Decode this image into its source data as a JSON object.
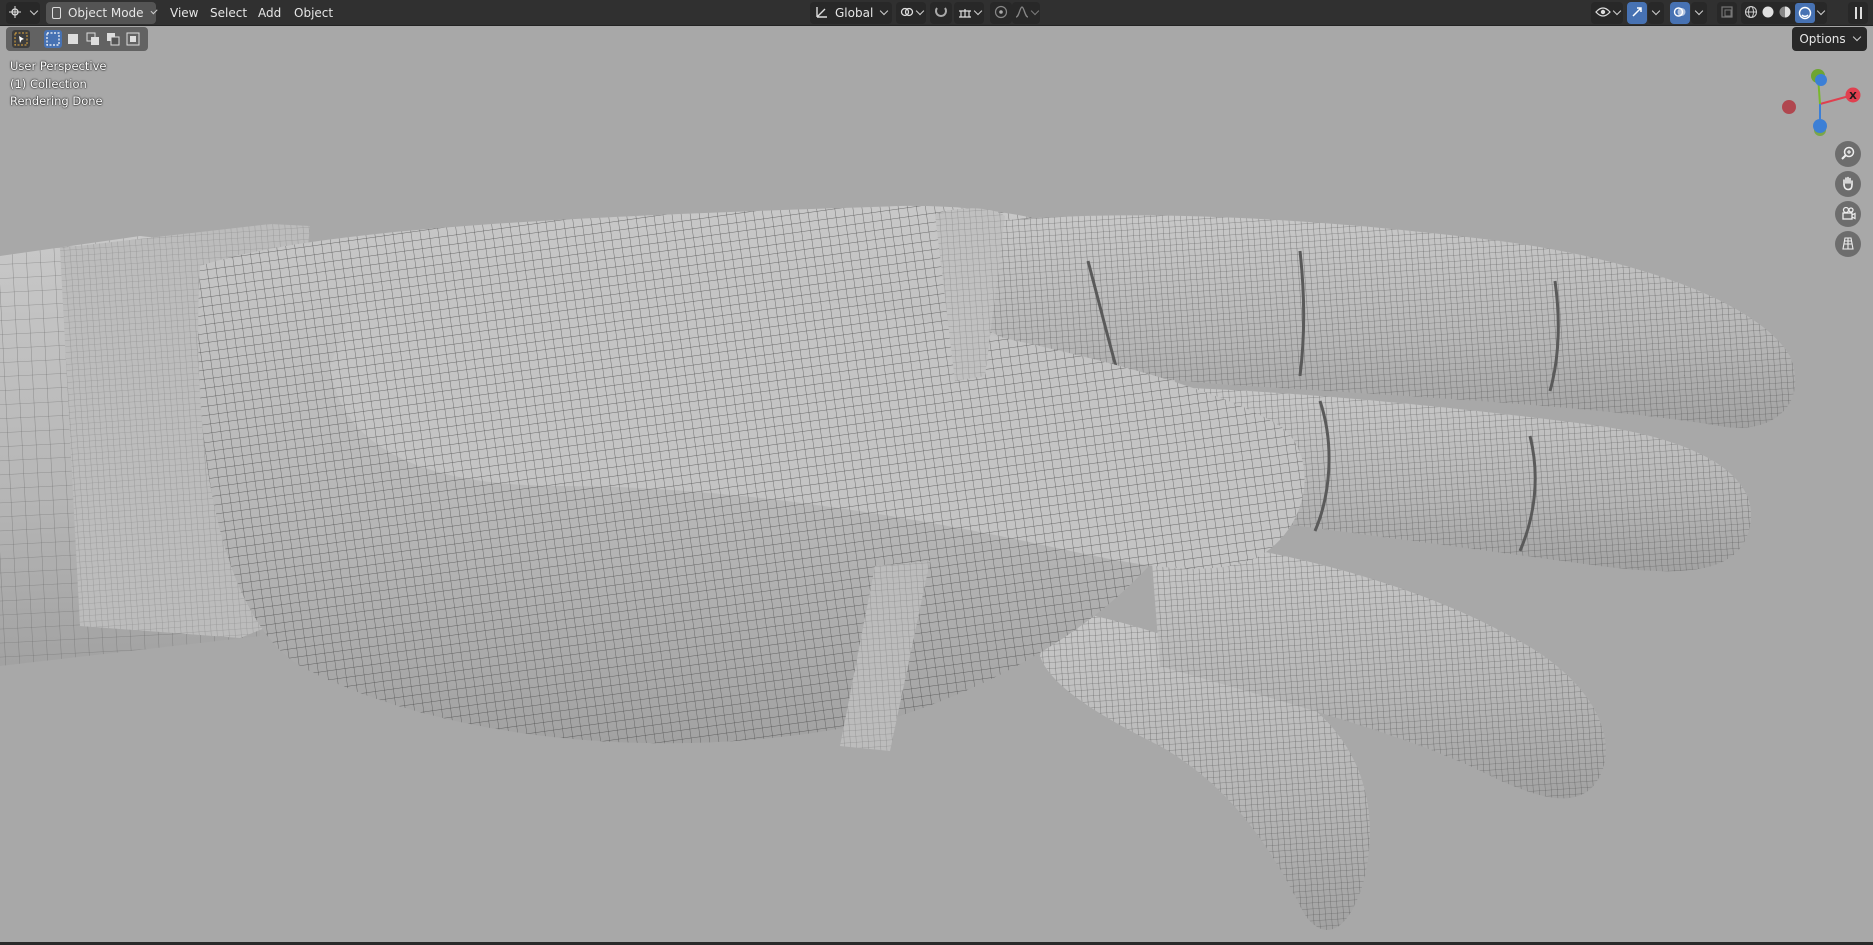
{
  "header": {
    "editor_type_icon": "3d-viewport-icon",
    "mode": {
      "label": "Object Mode",
      "icon": "object-mode-icon"
    },
    "menus": [
      "View",
      "Select",
      "Add",
      "Object"
    ],
    "transform_orientation": {
      "label": "Global",
      "icon": "orientation-global-icon"
    },
    "pivot_icon": "pivot-point-icon",
    "snap_icon": "snap-magnet-icon",
    "snap_target_icon": "snap-increment-icon",
    "proportional_icon": "proportional-edit-icon",
    "falloff_icon": "falloff-curve-icon",
    "visibility_icon": "eye-icon",
    "gizmo_icon": "gizmo-icon",
    "overlay_icon": "overlay-icon",
    "xray_icon": "xray-icon",
    "shading_modes": [
      "wireframe-shading-icon",
      "solid-shading-icon",
      "material-shading-icon",
      "rendered-shading-icon"
    ],
    "active_shading": "rendered-shading-icon",
    "collapse_icon": "pause-icon"
  },
  "toolbar": {
    "select_tools": [
      "select-box-icon",
      "select-new-icon",
      "select-extend-icon",
      "select-subtract-icon",
      "select-invert-icon"
    ],
    "active_tool_icon": "cursor-tool-icon"
  },
  "viewport": {
    "info_lines": {
      "perspective": "User Perspective",
      "collection": "(1) Collection",
      "status": "Rendering Done"
    },
    "options_label": "Options",
    "axis_gizmo": {
      "x_label": "X",
      "x_color": "#e0404f",
      "y_color": "#7ab72e",
      "z_color": "#3c7fd6"
    },
    "nav_buttons": [
      "zoom-icon",
      "hand-pan-icon",
      "camera-icon",
      "grid-ortho-icon"
    ]
  },
  "colors": {
    "background": "#a8a8a8",
    "header": "#303030",
    "accent": "#4772b3",
    "mesh_fill": "#bdbdbd",
    "wire": "#4d4d4d"
  }
}
